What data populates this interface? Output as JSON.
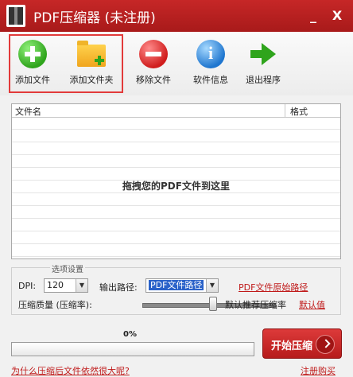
{
  "window": {
    "title": "PDF压缩器 (未注册)",
    "minimize_label": "_",
    "close_label": "X"
  },
  "toolbar": {
    "add_file": "添加文件",
    "add_folder": "添加文件夹",
    "remove_file": "移除文件",
    "software_info": "软件信息",
    "exit": "退出程序"
  },
  "filelist": {
    "columns": [
      "文件名",
      "格式"
    ],
    "drop_hint": "拖拽您的PDF文件到这里"
  },
  "options": {
    "legend": "选项设置",
    "dpi_label": "DPI:",
    "dpi_value": "120",
    "output_label": "输出路径:",
    "output_value": "PDF文件路径",
    "output_original_link": "PDF文件原始路径",
    "quality_label": "压缩质量 (压缩率):",
    "quality_level": 0.45,
    "recommended_label": "默认推荐压缩率",
    "default_link": "默认值"
  },
  "progress": {
    "value_text": "0%",
    "value": 0
  },
  "start_button": "开始压缩",
  "footer": {
    "why_link": "为什么压缩后文件依然很大呢?",
    "register_link": "注册购买"
  },
  "colors": {
    "brand": "#b72020",
    "link": "#c01a1a",
    "selection": "#2a62c9"
  }
}
